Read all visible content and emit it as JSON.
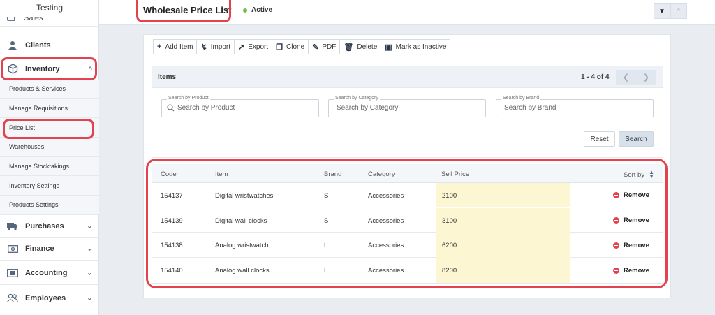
{
  "app": {
    "brand": "Testing"
  },
  "sidebar": {
    "partial_item": "Sales",
    "items": [
      {
        "label": "Clients",
        "icon": "clients-icon"
      },
      {
        "label": "Inventory",
        "icon": "box-icon",
        "expanded": true
      },
      {
        "label": "Purchases",
        "icon": "truck-icon"
      },
      {
        "label": "Finance",
        "icon": "money-icon"
      },
      {
        "label": "Accounting",
        "icon": "ledger-icon"
      },
      {
        "label": "Employees",
        "icon": "users-icon"
      }
    ],
    "sub_items": [
      {
        "label": "Products & Services"
      },
      {
        "label": "Manage Requisitions"
      },
      {
        "label": "Price List",
        "active": true
      },
      {
        "label": "Warehouses"
      },
      {
        "label": "Manage Stocktakings"
      },
      {
        "label": "Inventory Settings"
      },
      {
        "label": "Products Settings"
      }
    ]
  },
  "header": {
    "title": "Wholesale Price List",
    "status": "Active",
    "status_color": "#6cc04a"
  },
  "toolbar": {
    "add_item": "Add Item",
    "import": "Import",
    "export": "Export",
    "clone": "Clone",
    "pdf": "PDF",
    "delete": "Delete",
    "mark_inactive": "Mark as Inactive"
  },
  "items_section": {
    "title": "Items",
    "count": "1 - 4 of 4",
    "filters": {
      "product": {
        "legend": "Search by Product",
        "placeholder": "Search by Product"
      },
      "category": {
        "legend": "Search by Category",
        "placeholder": "Search by Category"
      },
      "brand": {
        "legend": "Search by Brand",
        "placeholder": "Search by Brand"
      }
    },
    "reset_label": "Reset",
    "search_label": "Search"
  },
  "table": {
    "headers": {
      "code": "Code",
      "item": "Item",
      "brand": "Brand",
      "category": "Category",
      "sell_price": "Sell Price",
      "sort_by": "Sort by"
    },
    "remove_label": "Remove",
    "rows": [
      {
        "code": "154137",
        "item": "Digital wristwatches",
        "brand": "S",
        "category": "Accessories",
        "price": "2100"
      },
      {
        "code": "154139",
        "item": "Digital wall clocks",
        "brand": "S",
        "category": "Accessories",
        "price": "3100"
      },
      {
        "code": "154138",
        "item": "Analog wristwatch",
        "brand": "L",
        "category": "Accessories",
        "price": "6200"
      },
      {
        "code": "154140",
        "item": "Analog wall clocks",
        "brand": "L",
        "category": "Accessories",
        "price": "8200"
      }
    ]
  },
  "colors": {
    "highlight": "#e3424f",
    "price_bg": "#fdf6d2",
    "remove_icon": "#e2424f"
  }
}
